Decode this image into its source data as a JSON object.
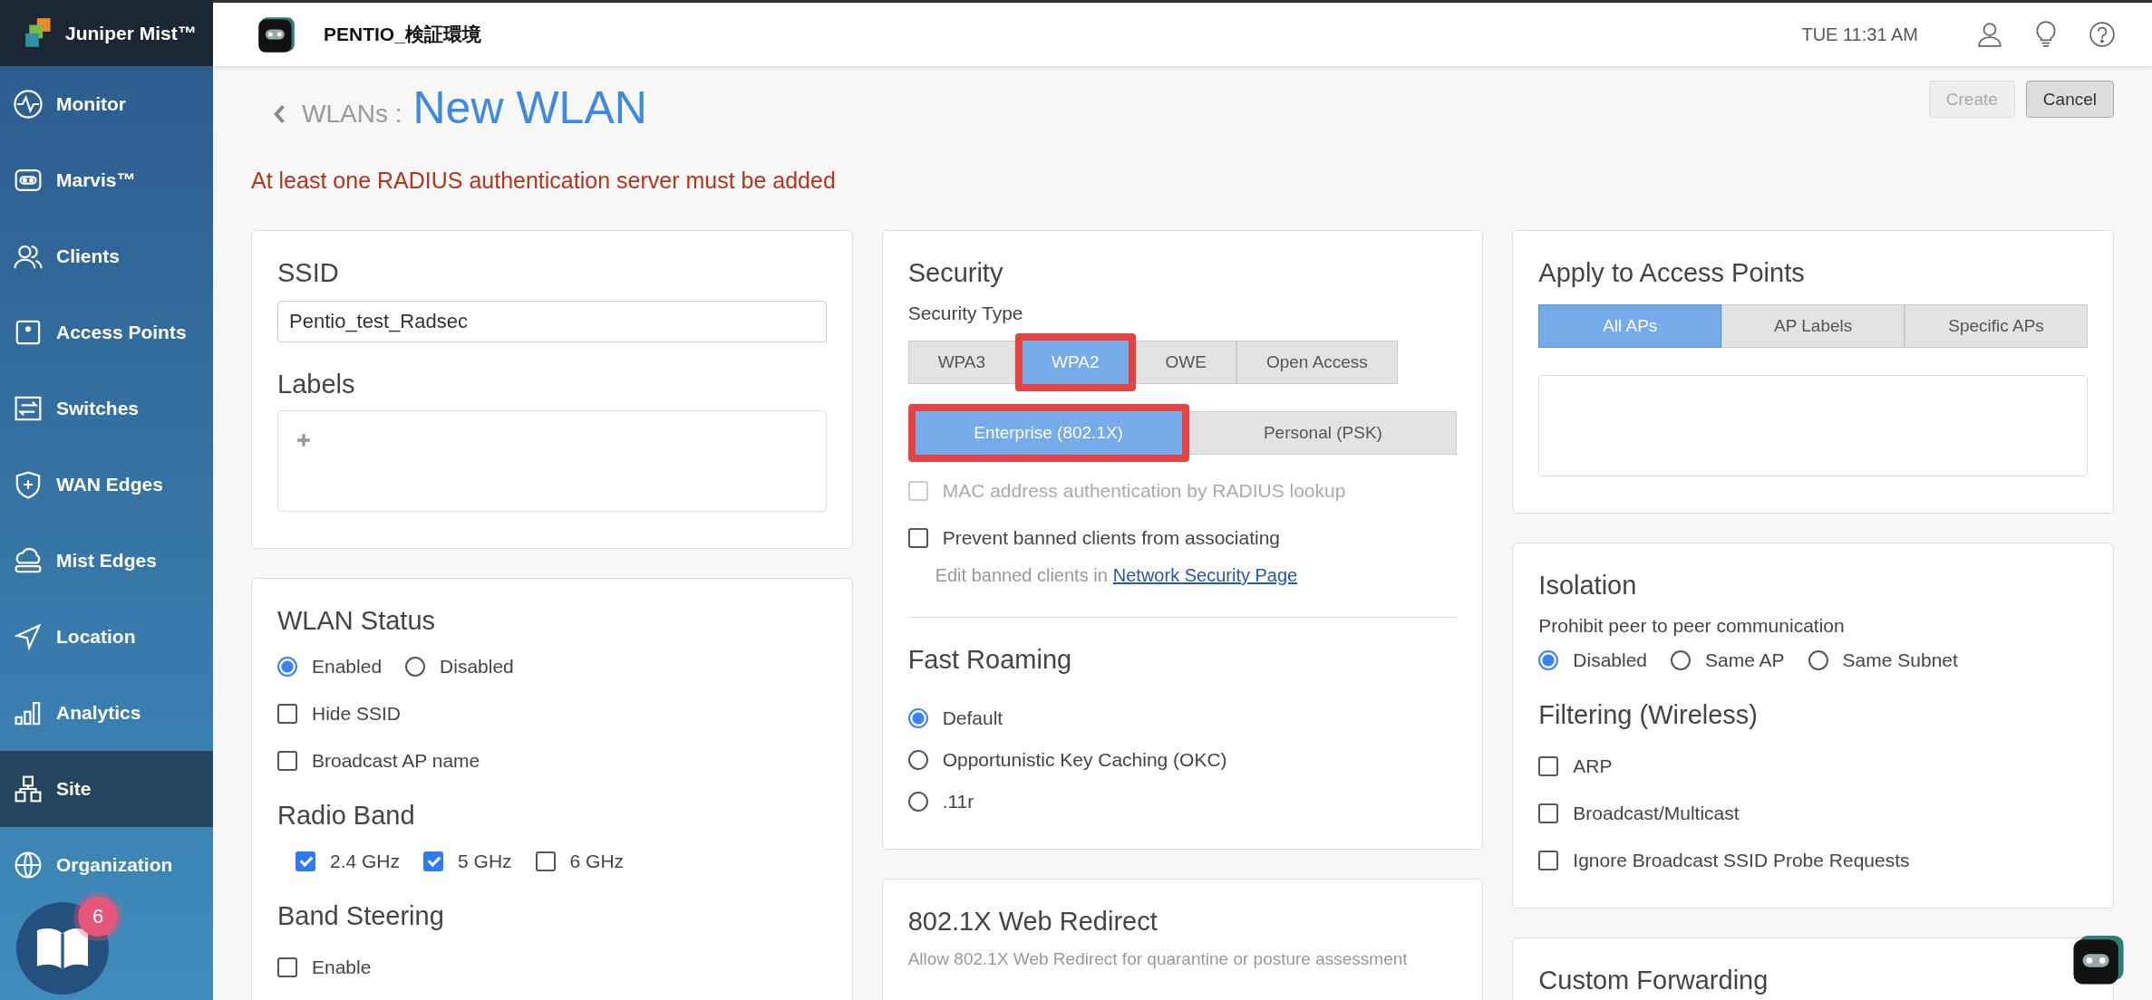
{
  "sidebar": {
    "brand": "Juniper Mist™",
    "items": [
      {
        "label": "Monitor",
        "selected": false
      },
      {
        "label": "Marvis™",
        "selected": false
      },
      {
        "label": "Clients",
        "selected": false
      },
      {
        "label": "Access Points",
        "selected": false
      },
      {
        "label": "Switches",
        "selected": false
      },
      {
        "label": "WAN Edges",
        "selected": false
      },
      {
        "label": "Mist Edges",
        "selected": false
      },
      {
        "label": "Location",
        "selected": false
      },
      {
        "label": "Analytics",
        "selected": false
      },
      {
        "label": "Site",
        "selected": true
      },
      {
        "label": "Organization",
        "selected": false
      }
    ],
    "help_badge": "6"
  },
  "topbar": {
    "org": "PENTIO_検証環境",
    "time": "TUE 11:31 AM"
  },
  "header": {
    "breadcrumb": "WLANs :",
    "title": "New WLAN",
    "buttons": [
      {
        "label": "Create",
        "disabled": true
      },
      {
        "label": "Cancel",
        "disabled": false
      }
    ],
    "error": "At least one RADIUS authentication server must be added"
  },
  "ssid_card": {
    "ssid_title": "SSID",
    "ssid_value": "Pentio_test_Radsec",
    "labels_title": "Labels"
  },
  "wlan_status": {
    "title": "WLAN Status",
    "status_options": [
      {
        "label": "Enabled",
        "selected": true
      },
      {
        "label": "Disabled",
        "selected": false
      }
    ],
    "options": [
      {
        "label": "Hide SSID",
        "checked": false
      },
      {
        "label": "Broadcast AP name",
        "checked": false
      }
    ],
    "radio_band_title": "Radio Band",
    "bands": [
      {
        "label": "2.4 GHz",
        "checked": true
      },
      {
        "label": "5 GHz",
        "checked": true
      },
      {
        "label": "6 GHz",
        "checked": false
      }
    ],
    "band_steering_title": "Band Steering",
    "band_steering": [
      {
        "label": "Enable",
        "checked": false
      }
    ]
  },
  "security": {
    "title": "Security",
    "type_label": "Security Type",
    "types": [
      {
        "label": "WPA3",
        "selected": false,
        "highlighted": false
      },
      {
        "label": "WPA2",
        "selected": true,
        "highlighted": true
      },
      {
        "label": "OWE",
        "selected": false,
        "highlighted": false
      },
      {
        "label": "Open Access",
        "selected": false,
        "highlighted": false
      }
    ],
    "modes": [
      {
        "label": "Enterprise (802.1X)",
        "selected": true,
        "highlighted": true
      },
      {
        "label": "Personal (PSK)",
        "selected": false,
        "highlighted": false
      }
    ],
    "options": [
      {
        "label": "MAC address authentication by RADIUS lookup",
        "checked": false,
        "disabled": true
      },
      {
        "label": "Prevent banned clients from associating",
        "checked": false,
        "disabled": false
      }
    ],
    "banned_note": "Edit banned clients in",
    "banned_link": "Network Security Page",
    "fast_roaming_title": "Fast Roaming",
    "fast_roaming": [
      {
        "label": "Default",
        "selected": true
      },
      {
        "label": "Opportunistic Key Caching (OKC)",
        "selected": false
      },
      {
        "label": ".11r",
        "selected": false
      }
    ]
  },
  "web_redirect": {
    "title": "802.1X Web Redirect",
    "description": "Allow 802.1X Web Redirect for quarantine or posture assessment"
  },
  "apply": {
    "title": "Apply to Access Points",
    "tabs": [
      {
        "label": "All APs",
        "selected": true
      },
      {
        "label": "AP Labels",
        "selected": false
      },
      {
        "label": "Specific APs",
        "selected": false
      }
    ]
  },
  "isolation": {
    "title": "Isolation",
    "subtitle": "Prohibit peer to peer communication",
    "options": [
      {
        "label": "Disabled",
        "selected": true
      },
      {
        "label": "Same AP",
        "selected": false
      },
      {
        "label": "Same Subnet",
        "selected": false
      }
    ],
    "filtering_title": "Filtering (Wireless)",
    "filters": [
      {
        "label": "ARP",
        "checked": false
      },
      {
        "label": "Broadcast/Multicast",
        "checked": false
      },
      {
        "label": "Ignore Broadcast SSID Probe Requests",
        "checked": false
      }
    ]
  },
  "custom_forwarding": {
    "title": "Custom Forwarding"
  }
}
